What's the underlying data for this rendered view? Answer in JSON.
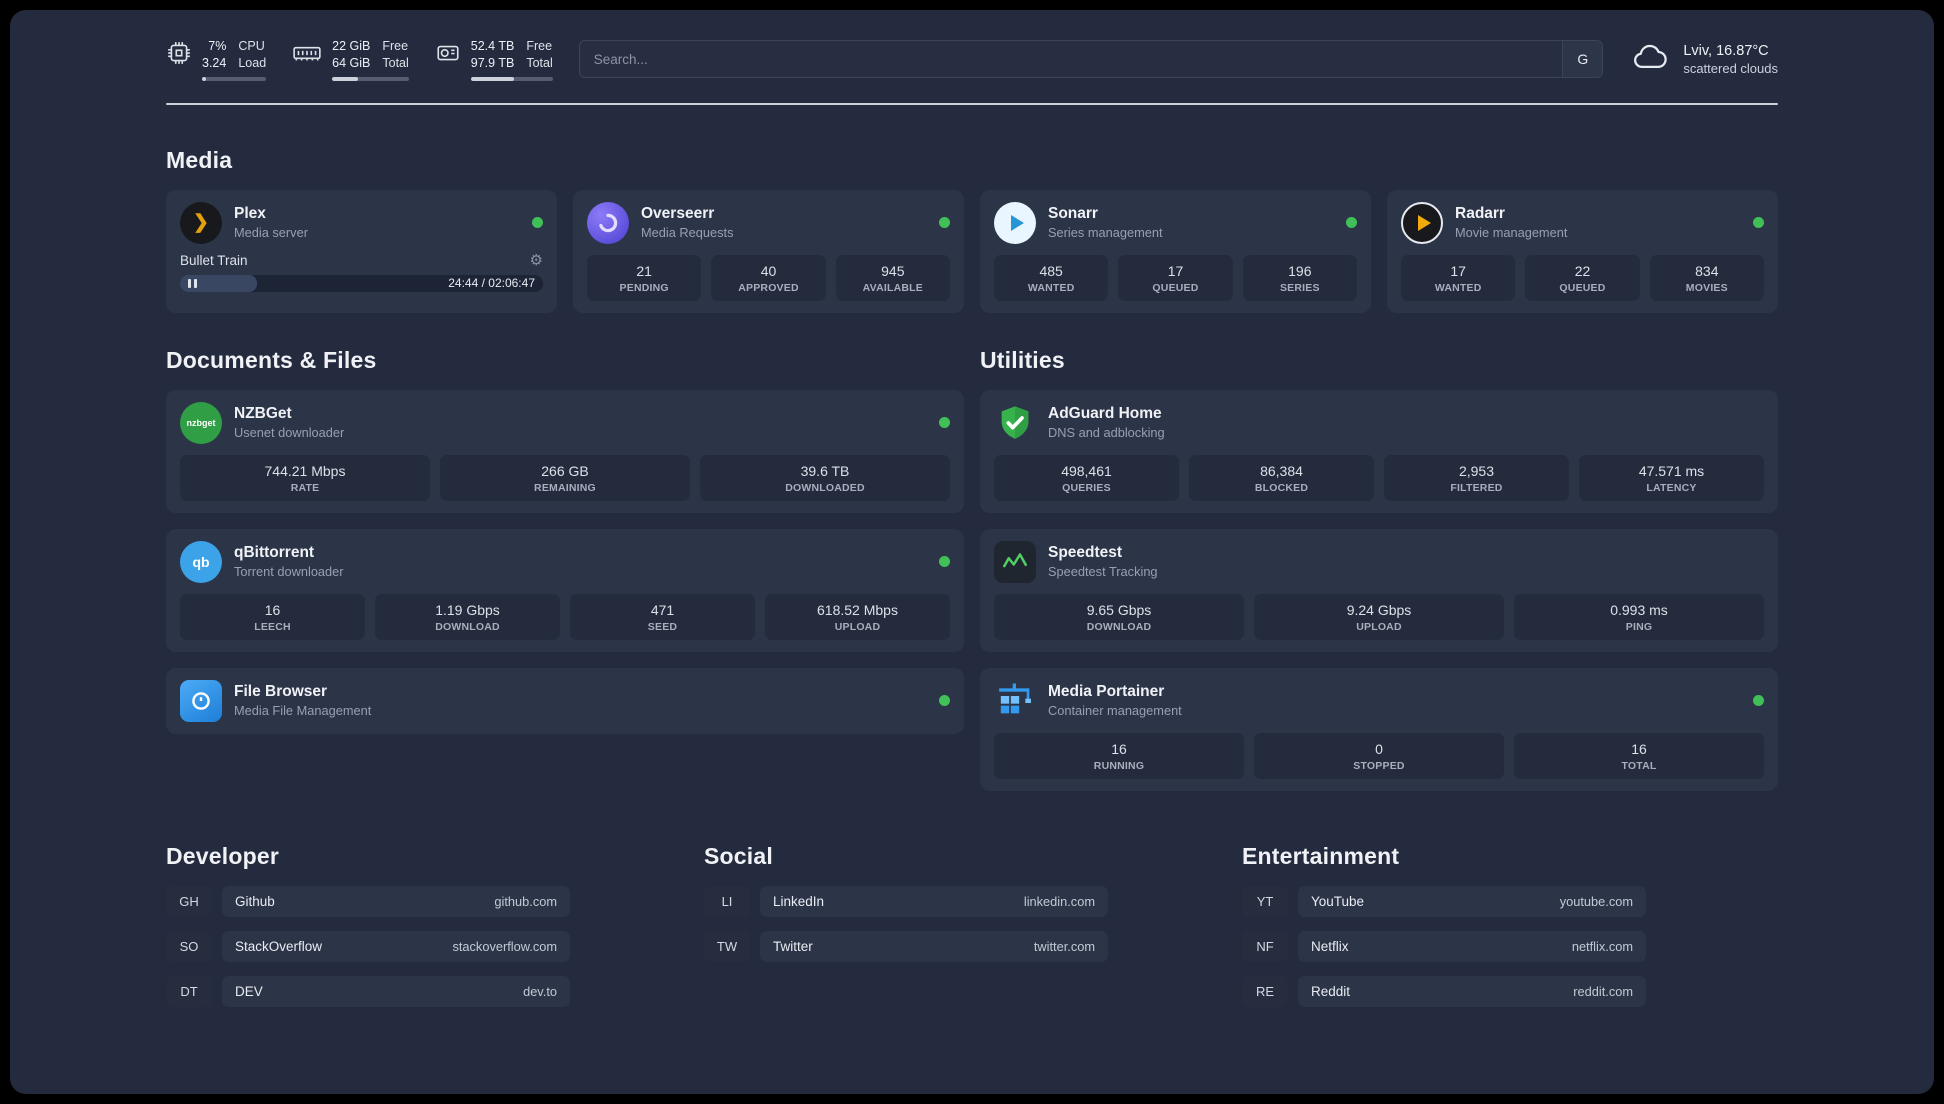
{
  "topbar": {
    "cpu": {
      "value_top": "7%",
      "value_bottom": "3.24",
      "label_top": "CPU",
      "label_bottom": "Load"
    },
    "ram": {
      "value_top": "22 GiB",
      "value_bottom": "64 GiB",
      "label_top": "Free",
      "label_bottom": "Total"
    },
    "disk": {
      "value_top": "52.4 TB",
      "value_bottom": "97.9 TB",
      "label_top": "Free",
      "label_bottom": "Total"
    },
    "search": {
      "placeholder": "Search...",
      "engine": "G"
    },
    "weather": {
      "location": "Lviv, 16.87°C",
      "condition": "scattered clouds"
    }
  },
  "media": {
    "heading": "Media",
    "plex": {
      "title": "Plex",
      "subtitle": "Media server",
      "now_playing": "Bullet Train",
      "time": "24:44 / 02:06:47"
    },
    "overseerr": {
      "title": "Overseerr",
      "subtitle": "Media Requests",
      "stats": [
        {
          "value": "21",
          "label": "PENDING"
        },
        {
          "value": "40",
          "label": "APPROVED"
        },
        {
          "value": "945",
          "label": "AVAILABLE"
        }
      ]
    },
    "sonarr": {
      "title": "Sonarr",
      "subtitle": "Series management",
      "stats": [
        {
          "value": "485",
          "label": "WANTED"
        },
        {
          "value": "17",
          "label": "QUEUED"
        },
        {
          "value": "196",
          "label": "SERIES"
        }
      ]
    },
    "radarr": {
      "title": "Radarr",
      "subtitle": "Movie management",
      "stats": [
        {
          "value": "17",
          "label": "WANTED"
        },
        {
          "value": "22",
          "label": "QUEUED"
        },
        {
          "value": "834",
          "label": "MOVIES"
        }
      ]
    }
  },
  "documents": {
    "heading": "Documents & Files",
    "nzbget": {
      "title": "NZBGet",
      "subtitle": "Usenet downloader",
      "icon_text": "nzbget",
      "stats": [
        {
          "value": "744.21 Mbps",
          "label": "RATE"
        },
        {
          "value": "266 GB",
          "label": "REMAINING"
        },
        {
          "value": "39.6 TB",
          "label": "DOWNLOADED"
        }
      ]
    },
    "qbittorrent": {
      "title": "qBittorrent",
      "subtitle": "Torrent downloader",
      "icon_text": "qb",
      "stats": [
        {
          "value": "16",
          "label": "LEECH"
        },
        {
          "value": "1.19 Gbps",
          "label": "DOWNLOAD"
        },
        {
          "value": "471",
          "label": "SEED"
        },
        {
          "value": "618.52 Mbps",
          "label": "UPLOAD"
        }
      ]
    },
    "filebrowser": {
      "title": "File Browser",
      "subtitle": "Media File Management"
    }
  },
  "utilities": {
    "heading": "Utilities",
    "adguard": {
      "title": "AdGuard Home",
      "subtitle": "DNS and adblocking",
      "stats": [
        {
          "value": "498,461",
          "label": "QUERIES"
        },
        {
          "value": "86,384",
          "label": "BLOCKED"
        },
        {
          "value": "2,953",
          "label": "FILTERED"
        },
        {
          "value": "47.571 ms",
          "label": "LATENCY"
        }
      ]
    },
    "speedtest": {
      "title": "Speedtest",
      "subtitle": "Speedtest Tracking",
      "stats": [
        {
          "value": "9.65 Gbps",
          "label": "DOWNLOAD"
        },
        {
          "value": "9.24 Gbps",
          "label": "UPLOAD"
        },
        {
          "value": "0.993 ms",
          "label": "PING"
        }
      ]
    },
    "portainer": {
      "title": "Media Portainer",
      "subtitle": "Container management",
      "stats": [
        {
          "value": "16",
          "label": "RUNNING"
        },
        {
          "value": "0",
          "label": "STOPPED"
        },
        {
          "value": "16",
          "label": "TOTAL"
        }
      ]
    }
  },
  "bookmarks": {
    "developer": {
      "heading": "Developer",
      "items": [
        {
          "abbr": "GH",
          "name": "Github",
          "url": "github.com"
        },
        {
          "abbr": "SO",
          "name": "StackOverflow",
          "url": "stackoverflow.com"
        },
        {
          "abbr": "DT",
          "name": "DEV",
          "url": "dev.to"
        }
      ]
    },
    "social": {
      "heading": "Social",
      "items": [
        {
          "abbr": "LI",
          "name": "LinkedIn",
          "url": "linkedin.com"
        },
        {
          "abbr": "TW",
          "name": "Twitter",
          "url": "twitter.com"
        }
      ]
    },
    "entertainment": {
      "heading": "Entertainment",
      "items": [
        {
          "abbr": "YT",
          "name": "YouTube",
          "url": "youtube.com"
        },
        {
          "abbr": "NF",
          "name": "Netflix",
          "url": "netflix.com"
        },
        {
          "abbr": "RE",
          "name": "Reddit",
          "url": "reddit.com"
        }
      ]
    }
  },
  "colors": {
    "status_online": "#40c057"
  }
}
